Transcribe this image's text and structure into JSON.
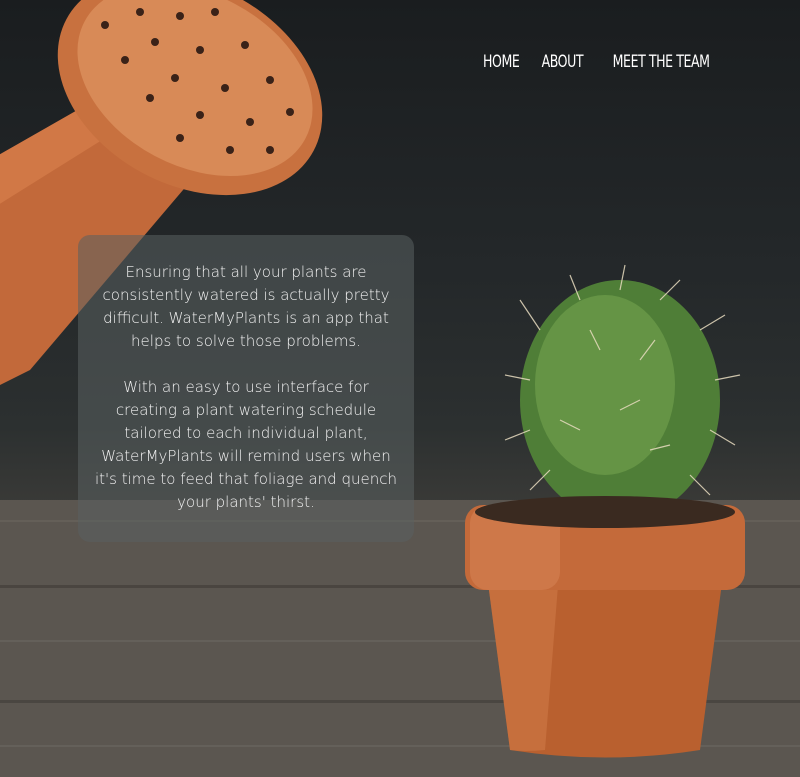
{
  "nav": {
    "items": [
      {
        "label": "HOME"
      },
      {
        "label": "ABOUT"
      },
      {
        "label": "MEET THE TEAM"
      }
    ]
  },
  "about": {
    "paragraphs": [
      "Ensuring that all your plants are consistently watered is actually pretty difficult. WaterMyPlants is an app that helps to solve those problems.",
      "With an easy to use interface for creating a plant watering schedule tailored to each individual plant, WaterMyPlants will remind users when it's time to feed that foliage and quench your plants' thirst."
    ]
  },
  "colors": {
    "background": "#24282a",
    "terracotta": "#c46a3a",
    "cactus_green": "#5a8a3c",
    "text": "#ffffff"
  }
}
